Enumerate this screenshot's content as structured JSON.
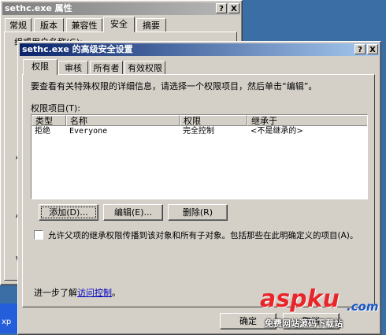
{
  "back_window": {
    "title": "sethc.exe 属性",
    "help_btn": "?",
    "close_btn": "X",
    "tabs": [
      "常规",
      "版本",
      "兼容性",
      "安全",
      "摘要"
    ],
    "group_label": "组或用户名称(G):",
    "side_letters": [
      "A",
      "A",
      "W"
    ]
  },
  "dialog": {
    "title": "sethc.exe 的高级安全设置",
    "help_btn": "?",
    "close_btn": "X",
    "tabs": [
      "权限",
      "审核",
      "所有者",
      "有效权限"
    ],
    "instruction": "要查看有关特殊权限的详细信息，请选择一个权限项目，然后单击“编辑”。",
    "list_label": "权限项目(T):",
    "columns": [
      "类型",
      "名称",
      "权限",
      "继承于"
    ],
    "rows": [
      {
        "type": "拒绝",
        "name": "Everyone",
        "permission": "完全控制",
        "inherited": "<不是继承的>"
      }
    ],
    "add_button": "添加(D)...",
    "edit_button": "编辑(E)...",
    "remove_button": "删除(R)",
    "inherit_checkbox": "允许父项的继承权限传播到该对象和所有子对象。包括那些在此明确定义的项目(A)。",
    "inherit_checked": false,
    "learn_more_prefix": "进一步了解",
    "learn_more_link": "访问控制",
    "learn_more_suffix": "。",
    "ok_button": "确定",
    "cancel_button": "取消"
  },
  "taskbar": {
    "label": "xp"
  },
  "watermark": {
    "brand": "aspku",
    "dot": ".com",
    "tagline": "免费网站源码下载站"
  }
}
